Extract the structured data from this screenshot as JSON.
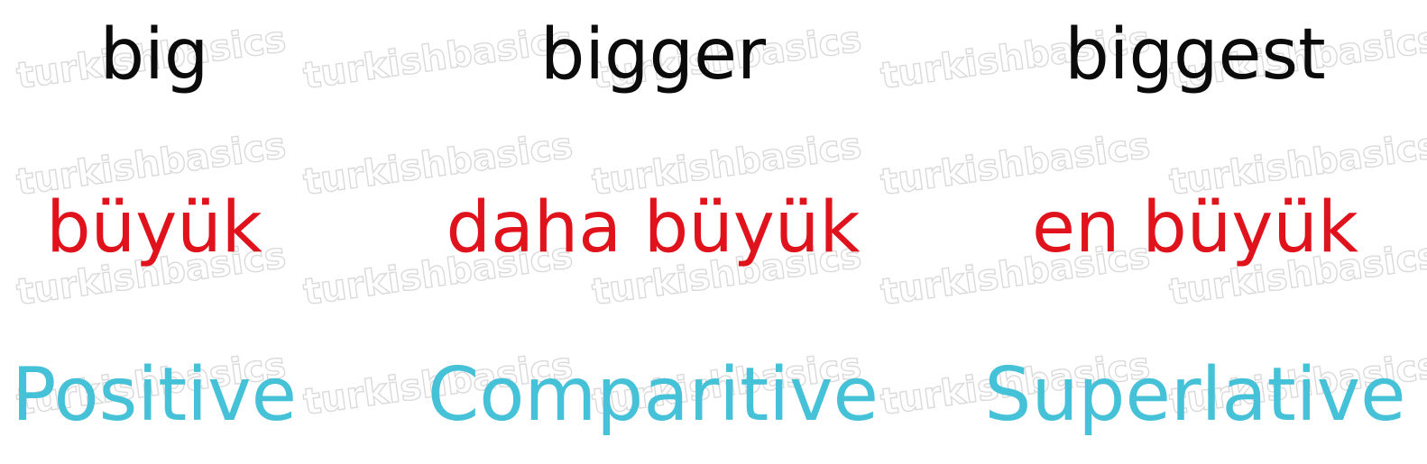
{
  "watermark_text": "turkishbasics",
  "colors": {
    "english": "#0b0b0b",
    "turkish": "#e0121c",
    "term": "#45c1d8",
    "watermark": "#dadada"
  },
  "columns": [
    {
      "english": "big",
      "turkish": "büyük",
      "term": "Positive"
    },
    {
      "english": "bigger",
      "turkish": "daha büyük",
      "term": "Comparitive"
    },
    {
      "english": "biggest",
      "turkish": "en büyük",
      "term": "Superlative"
    }
  ]
}
